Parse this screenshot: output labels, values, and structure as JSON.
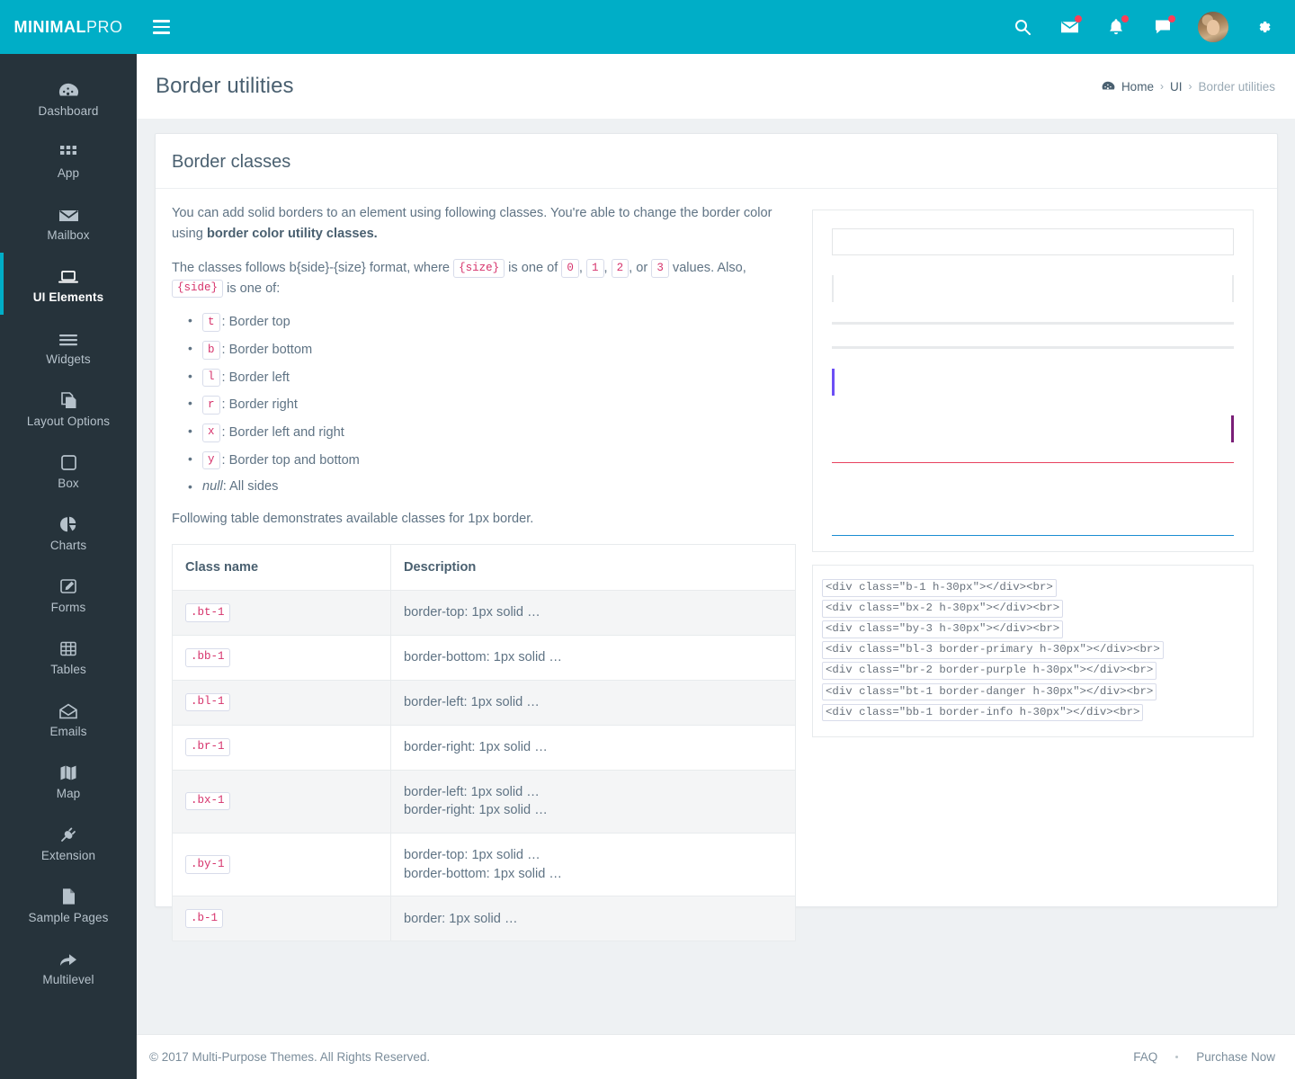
{
  "brand": {
    "part1": "MINIMAL",
    "part2": "PRO"
  },
  "topbar": {
    "menu_toggle": "menu-toggle",
    "icons": [
      "search-icon",
      "mail-icon",
      "bell-icon",
      "chat-icon",
      "avatar",
      "gear-icon"
    ],
    "accent_color": "#00aec7"
  },
  "sidebar": {
    "active": "UI Elements",
    "items": [
      {
        "label": "Dashboard",
        "icon": "speedometer-icon"
      },
      {
        "label": "App",
        "icon": "grid-icon"
      },
      {
        "label": "Mailbox",
        "icon": "envelope-icon"
      },
      {
        "label": "UI Elements",
        "icon": "laptop-icon"
      },
      {
        "label": "Widgets",
        "icon": "bars-icon"
      },
      {
        "label": "Layout Options",
        "icon": "copy-icon"
      },
      {
        "label": "Box",
        "icon": "square-icon"
      },
      {
        "label": "Charts",
        "icon": "pie-chart-icon"
      },
      {
        "label": "Forms",
        "icon": "pencil-square-icon"
      },
      {
        "label": "Tables",
        "icon": "table-icon"
      },
      {
        "label": "Emails",
        "icon": "open-envelope-icon"
      },
      {
        "label": "Map",
        "icon": "map-icon"
      },
      {
        "label": "Extension",
        "icon": "plug-icon"
      },
      {
        "label": "Sample Pages",
        "icon": "file-icon"
      },
      {
        "label": "Multilevel",
        "icon": "arrow-share-icon"
      }
    ]
  },
  "page": {
    "title": "Border utilities",
    "breadcrumb": {
      "home": "Home",
      "sep1": "›",
      "section": "UI",
      "sep2": "›",
      "current": "Border utilities"
    }
  },
  "card": {
    "title": "Border classes",
    "intro_1a": "You can add solid borders to an element using following classes. You're able to change the border color using ",
    "intro_1b": "border color utility classes.",
    "intro_2a": "The classes follows b{side}-{size} format, where ",
    "size_token": "{size}",
    "intro_2b": " is one of ",
    "values": [
      "0",
      "1",
      "2",
      "3"
    ],
    "intro_2c": " values. Also, ",
    "side_token": "{side}",
    "intro_2d": " is one of:",
    "or_text": "or",
    "side_list": [
      {
        "token": "t",
        "desc": ": Border top"
      },
      {
        "token": "b",
        "desc": ": Border bottom"
      },
      {
        "token": "l",
        "desc": ": Border left"
      },
      {
        "token": "r",
        "desc": ": Border right"
      },
      {
        "token": "x",
        "desc": ": Border left and right"
      },
      {
        "token": "y",
        "desc": ": Border top and bottom"
      }
    ],
    "null_item_em": "null",
    "null_item_rest": ": All sides",
    "table_intro": "Following table demonstrates available classes for 1px border.",
    "table": {
      "headers": [
        "Class name",
        "Description"
      ],
      "rows": [
        {
          "cls": ".bt-1",
          "desc": "border-top: 1px solid …"
        },
        {
          "cls": ".bb-1",
          "desc": "border-bottom: 1px solid …"
        },
        {
          "cls": ".bl-1",
          "desc": "border-left: 1px solid …"
        },
        {
          "cls": ".br-1",
          "desc": "border-right: 1px solid …"
        },
        {
          "cls": ".bx-1",
          "desc": "border-left: 1px solid …\nborder-right: 1px solid …"
        },
        {
          "cls": ".by-1",
          "desc": "border-top: 1px solid …\nborder-bottom: 1px solid …"
        },
        {
          "cls": ".b-1",
          "desc": "border: 1px solid …"
        }
      ]
    }
  },
  "demo": {
    "rows": [
      {
        "name": "b-1",
        "style": "d-b1"
      },
      {
        "name": "bx-2",
        "style": "d-bx2"
      },
      {
        "name": "by-3",
        "style": "d-by3"
      },
      {
        "name": "bl-3-border-primary",
        "style": "d-bl3"
      },
      {
        "name": "br-2-border-purple",
        "style": "d-br2"
      },
      {
        "name": "bt-1-border-danger",
        "style": "d-bt1"
      },
      {
        "name": "bb-1-border-info",
        "style": "d-bb1"
      }
    ],
    "colors": {
      "primary": "#6c4ff5",
      "purple": "#7a1f77",
      "danger": "#e8425f",
      "info": "#1b8ed2",
      "default": "#e8eaec"
    },
    "code_lines": [
      "<div class=\"b-1 h-30px\"></div><br>",
      "<div class=\"bx-2 h-30px\"></div><br>",
      "<div class=\"by-3 h-30px\"></div><br>",
      "<div class=\"bl-3 border-primary h-30px\"></div><br>",
      "<div class=\"br-2 border-purple h-30px\"></div><br>",
      "<div class=\"bt-1 border-danger h-30px\"></div><br>",
      "<div class=\"bb-1 border-info h-30px\"></div><br>"
    ]
  },
  "footer": {
    "copyright": "© 2017 Multi-Purpose Themes. All Rights Reserved.",
    "faq": "FAQ",
    "purchase": "Purchase Now"
  }
}
